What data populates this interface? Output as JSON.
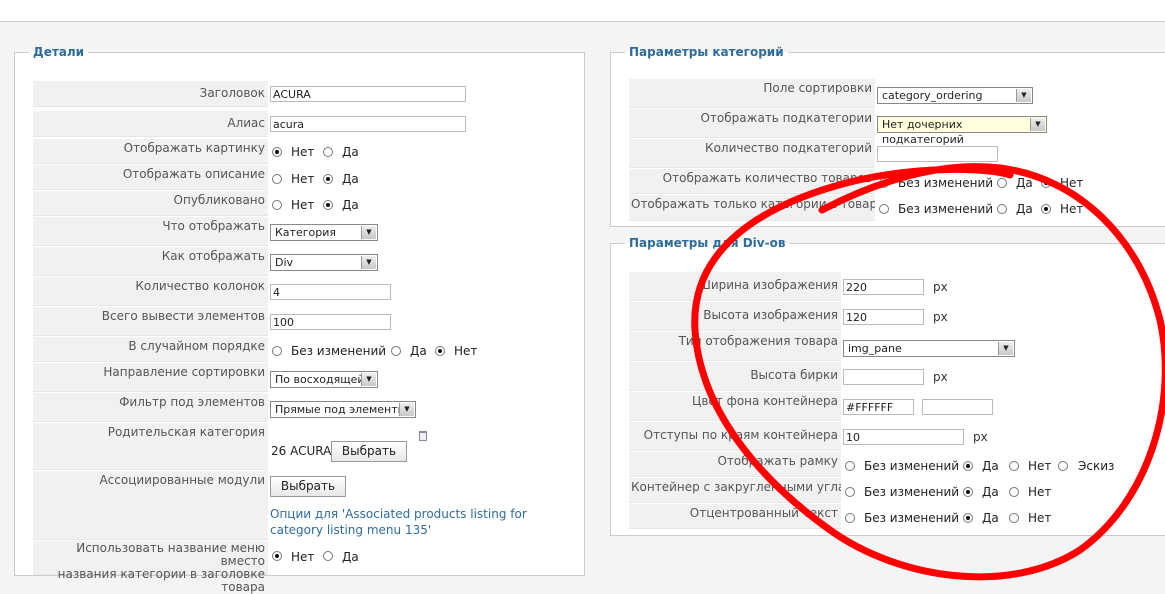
{
  "left": {
    "legend": "Детали",
    "title_label": "Заголовок",
    "title_value": "ACURA",
    "alias_label": "Алиас",
    "alias_value": "acura",
    "show_image_label": "Отображать картинку",
    "show_desc_label": "Отображать описание",
    "published_label": "Опубликовано",
    "no": "Нет",
    "yes": "Да",
    "no_change": "Без изменений",
    "what_label": "Что отображать",
    "what_value": "Категория",
    "how_label": "Как отображать",
    "how_value": "Div",
    "cols_label": "Количество колонок",
    "cols_value": "4",
    "total_label": "Всего вывести элементов",
    "total_value": "100",
    "random_label": "В случайном порядке",
    "sort_dir_label": "Направление сортировки",
    "sort_dir_value": "По восходящей",
    "filter_label": "Фильтр под элементов",
    "filter_value": "Прямые под элементы",
    "parent_label": "Родительская категория",
    "parent_value": "26 ACURA",
    "choose": "Выбрать",
    "assoc_label": "Ассоциированные модули",
    "assoc_link": "Опции для 'Associated products listing for category listing menu 135'",
    "menu_name_label_1": "Использовать название меню вместо",
    "menu_name_label_2": "названия категории в заголовке товара"
  },
  "cat": {
    "legend": "Параметры категорий",
    "sort_label": "Поле сортировки",
    "sort_value": "category_ordering",
    "sub_label": "Отображать подкатегории",
    "sub_value": "Нет дочерних подкатегорий",
    "subcount_label": "Количество подкатегорий",
    "prodcount_label": "Отображать количество товаров",
    "only_label": "Отображать только категории с товарами",
    "no_change": "Без изменений",
    "yes": "Да",
    "no": "Нет"
  },
  "div": {
    "legend": "Параметры для Div-ов",
    "img_w_label": "Ширина изображения",
    "img_w_value": "220",
    "img_h_label": "Высота изображения",
    "img_h_value": "120",
    "type_label": "Тип отображения товара",
    "type_value": "img_pane",
    "tag_h_label": "Высота бирки",
    "bg_label": "Цвет фона контейнера",
    "bg_value": "#FFFFFF",
    "pad_label": "Отступы по краям контейнера",
    "pad_value": "10",
    "frame_label": "Отображать рамку",
    "round_label": "Контейнер с закругленными углами",
    "center_label": "Отцентрованный текст",
    "px": "px",
    "no_change": "Без изменений",
    "yes": "Да",
    "no": "Нет",
    "sketch": "Эскиз"
  },
  "colors": {
    "accent": "#2e6c9c",
    "label_bg": "#f1f1f1",
    "annotation": "#ff0000"
  }
}
